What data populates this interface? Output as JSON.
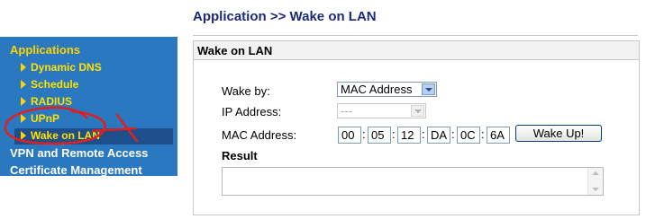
{
  "header": {
    "title": "Application >> Wake on LAN"
  },
  "sidebar": {
    "section": "Applications",
    "items": [
      {
        "label": "Dynamic DNS"
      },
      {
        "label": "Schedule"
      },
      {
        "label": "RADIUS"
      },
      {
        "label": "UPnP"
      },
      {
        "label": "Wake on LAN"
      }
    ],
    "groups": [
      {
        "label": "VPN and Remote Access"
      },
      {
        "label": "Certificate Management"
      }
    ]
  },
  "panel": {
    "title": "Wake on LAN"
  },
  "form": {
    "wake_by_label": "Wake by:",
    "wake_by_value": "MAC Address",
    "ip_label": "IP Address:",
    "ip_value": "---",
    "mac_label": "MAC Address:",
    "mac": [
      "00",
      "05",
      "12",
      "DA",
      "0C",
      "6A"
    ],
    "wake_button": "Wake Up!",
    "result_label": "Result"
  },
  "colors": {
    "sidebar": "#2a78c0",
    "sidebar_text": "#ffd200",
    "title": "#1c2a78",
    "annotation": "#e02020"
  }
}
